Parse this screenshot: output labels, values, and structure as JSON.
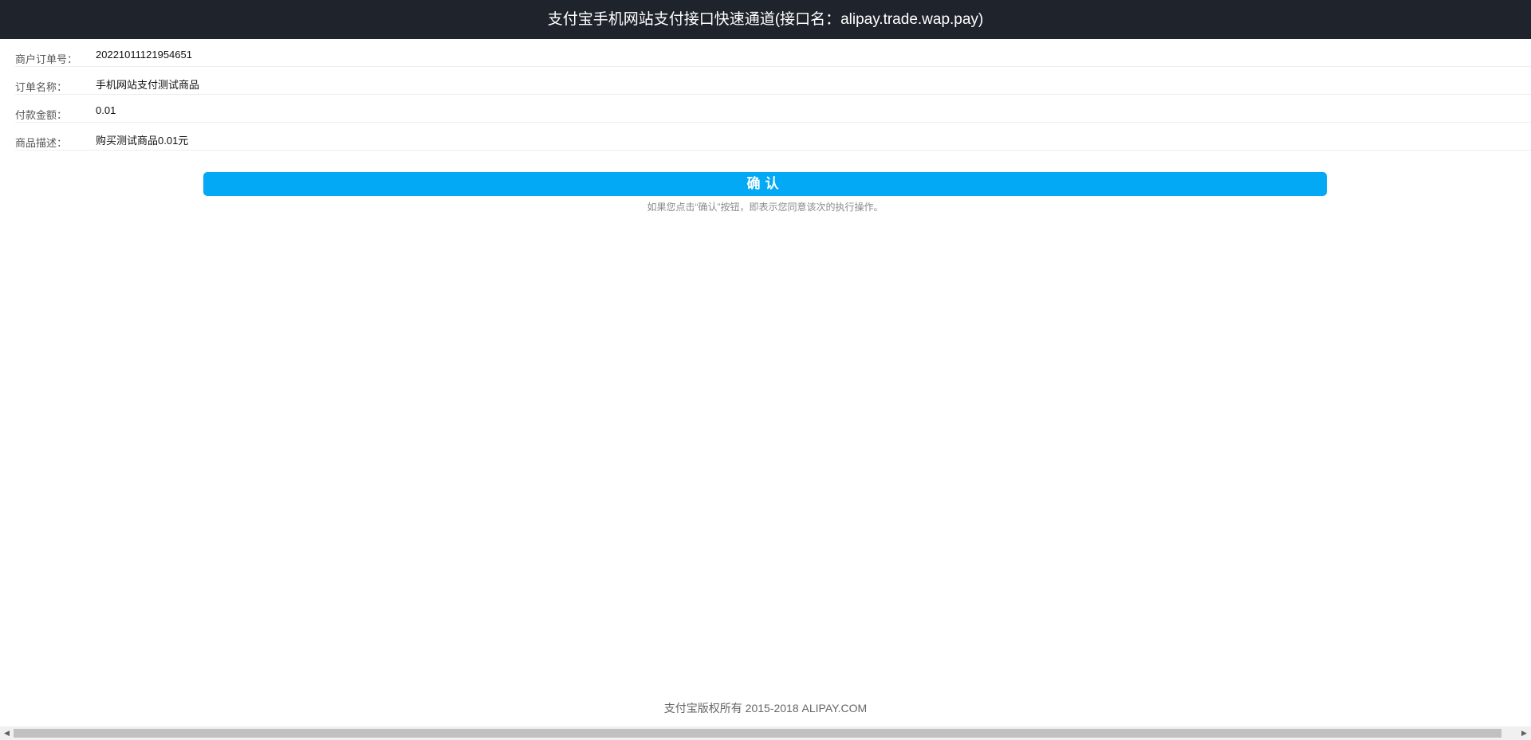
{
  "header": {
    "title": "支付宝手机网站支付接口快速通道(接口名：alipay.trade.wap.pay)"
  },
  "order": {
    "rows": [
      {
        "label": "商户订单号：",
        "value": "20221011121954651"
      },
      {
        "label": "订单名称：",
        "value": "手机网站支付测试商品"
      },
      {
        "label": "付款金额：",
        "value": "0.01"
      },
      {
        "label": "商品描述：",
        "value": "购买测试商品0.01元"
      }
    ]
  },
  "actions": {
    "confirm_label": "确认",
    "hint": "如果您点击“确认”按钮，即表示您同意该次的执行操作。"
  },
  "footer": {
    "copyright": "支付宝版权所有 2015-2018 ALIPAY.COM"
  },
  "icons": {
    "scroll_left": "triangle-left-icon",
    "scroll_right": "triangle-right-icon"
  },
  "colors": {
    "header_bg": "#1f232c",
    "confirm_bg": "#03a9f4"
  }
}
